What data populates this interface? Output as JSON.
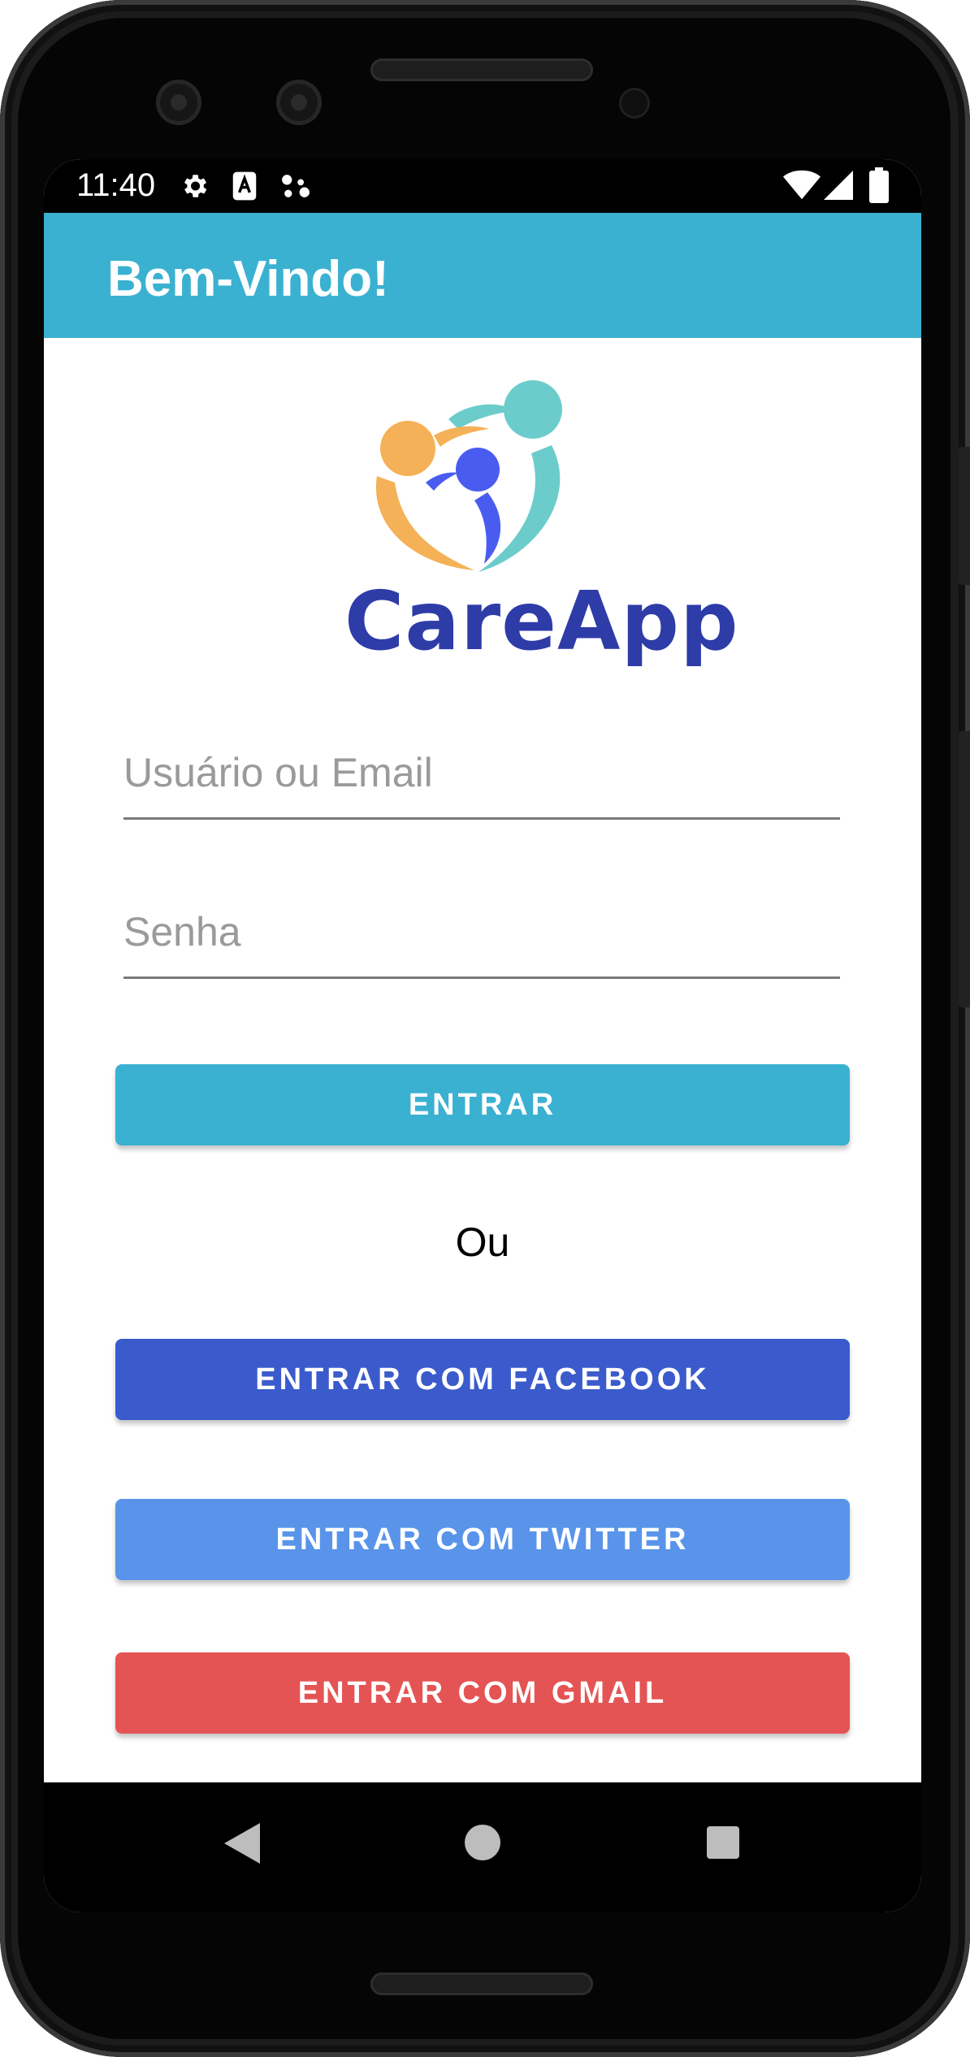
{
  "status_bar": {
    "time": "11:40",
    "left_icons": [
      "gear-icon",
      "text-a-icon",
      "assistant-dots-icon"
    ],
    "right_icons": [
      "wifi-icon",
      "cell-signal-icon",
      "battery-icon"
    ]
  },
  "app_bar": {
    "title": "Bem-Vindo!",
    "background": "#3bb1d1"
  },
  "logo": {
    "text": "CareApp",
    "colors": {
      "orange": "#f4b157",
      "teal": "#6ccccc",
      "blue": "#4a5cf0",
      "text": "#2e3ca8"
    }
  },
  "form": {
    "username_placeholder": "Usuário ou Email",
    "password_placeholder": "Senha"
  },
  "buttons": {
    "login": {
      "label": "ENTRAR",
      "color": "#3bb1d1"
    },
    "separator": "Ou",
    "facebook": {
      "label": "ENTRAR COM FACEBOOK",
      "color": "#3b5bcc"
    },
    "twitter": {
      "label": "ENTRAR COM TWITTER",
      "color": "#5994ea"
    },
    "gmail": {
      "label": "ENTRAR COM GMAIL",
      "color": "#e45454"
    }
  },
  "nav_bar": {
    "icons": [
      "back-icon",
      "home-icon",
      "recents-icon"
    ]
  }
}
